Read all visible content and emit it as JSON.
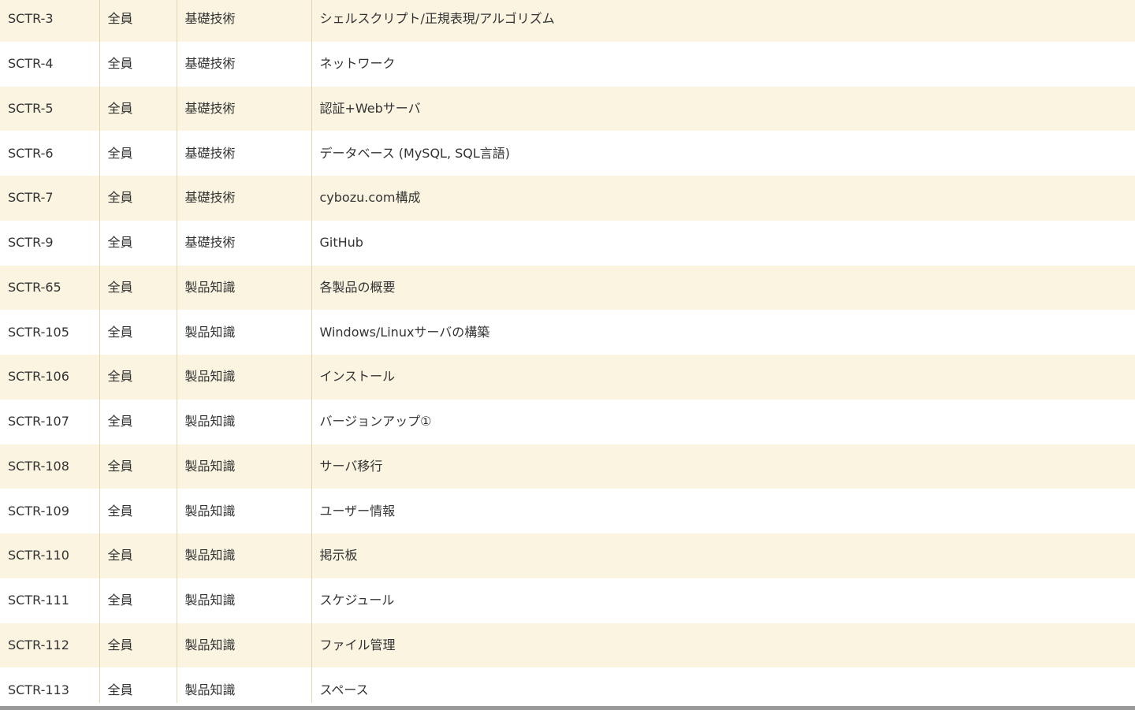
{
  "table": {
    "rows": [
      {
        "id": "SCTR-3",
        "target": "全員",
        "category": "基礎技術",
        "title": "シェルスクリプト/正規表現/アルゴリズム"
      },
      {
        "id": "SCTR-4",
        "target": "全員",
        "category": "基礎技術",
        "title": "ネットワーク"
      },
      {
        "id": "SCTR-5",
        "target": "全員",
        "category": "基礎技術",
        "title": "認証+Webサーバ"
      },
      {
        "id": "SCTR-6",
        "target": "全員",
        "category": "基礎技術",
        "title": "データベース (MySQL, SQL言語)"
      },
      {
        "id": "SCTR-7",
        "target": "全員",
        "category": "基礎技術",
        "title": "cybozu.com構成"
      },
      {
        "id": "SCTR-9",
        "target": "全員",
        "category": "基礎技術",
        "title": "GitHub"
      },
      {
        "id": "SCTR-65",
        "target": "全員",
        "category": "製品知識",
        "title": "各製品の概要"
      },
      {
        "id": "SCTR-105",
        "target": "全員",
        "category": "製品知識",
        "title": "Windows/Linuxサーバの構築"
      },
      {
        "id": "SCTR-106",
        "target": "全員",
        "category": "製品知識",
        "title": "インストール"
      },
      {
        "id": "SCTR-107",
        "target": "全員",
        "category": "製品知識",
        "title": "バージョンアップ①"
      },
      {
        "id": "SCTR-108",
        "target": "全員",
        "category": "製品知識",
        "title": "サーバ移行"
      },
      {
        "id": "SCTR-109",
        "target": "全員",
        "category": "製品知識",
        "title": "ユーザー情報"
      },
      {
        "id": "SCTR-110",
        "target": "全員",
        "category": "製品知識",
        "title": "掲示板"
      },
      {
        "id": "SCTR-111",
        "target": "全員",
        "category": "製品知識",
        "title": "スケジュール"
      },
      {
        "id": "SCTR-112",
        "target": "全員",
        "category": "製品知識",
        "title": "ファイル管理"
      },
      {
        "id": "SCTR-113",
        "target": "全員",
        "category": "製品知識",
        "title": "スペース"
      }
    ]
  },
  "colors": {
    "row_alt": "#faf4e1",
    "row_base": "#ffffff",
    "border": "#e2d7b4",
    "scrollbar": "#999999"
  }
}
